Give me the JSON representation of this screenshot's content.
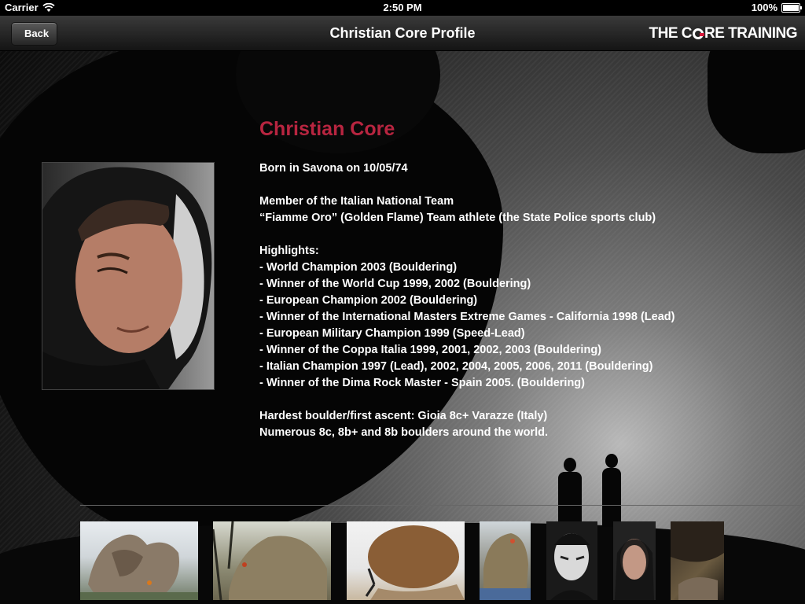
{
  "status_bar": {
    "carrier": "Carrier",
    "time": "2:50 PM",
    "battery": "100%"
  },
  "nav": {
    "back_label": "Back",
    "title": "Christian Core Profile",
    "brand_pre": "THE C",
    "brand_post": "RE TRAINING"
  },
  "profile": {
    "name": "Christian Core",
    "born": "Born in Savona on 10/05/74",
    "member_line_1": "Member of the Italian National Team",
    "member_line_2": "“Fiamme Oro” (Golden Flame) Team athlete (the State Police sports club)",
    "highlights_heading": "Highlights:",
    "highlights": [
      "- World Champion 2003 (Bouldering)",
      "- Winner of the World Cup 1999, 2002 (Bouldering)",
      "- European Champion 2002 (Bouldering)",
      "- Winner of the International Masters Extreme Games - California 1998 (Lead)",
      "- European Military Champion 1999 (Speed-Lead)",
      "- Winner of the Coppa Italia 1999, 2001, 2002, 2003 (Bouldering)",
      "- Italian Champion 1997 (Lead), 2002, 2004, 2005, 2006, 2011 (Bouldering)",
      "- Winner of the Dima Rock Master - Spain 2005. (Bouldering)"
    ],
    "hardest": "Hardest boulder/first ascent: Gioia 8c+ Varazze (Italy)",
    "numerous": "Numerous 8c, 8b+ and 8b boulders around the world."
  },
  "colors": {
    "name_accent": "#b82540",
    "logo_accent": "#d4193a"
  },
  "icons": {
    "wifi": "wifi-icon",
    "battery": "battery-icon",
    "back": "back-arrow-icon"
  }
}
